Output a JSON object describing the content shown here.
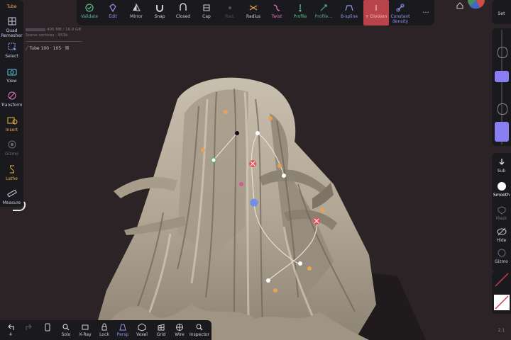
{
  "colors": {
    "background": "#2b2326",
    "panel": "#1a1a1e",
    "hair": "#b5aa98",
    "accent_purple": "#8a7ff2",
    "accent_red": "#b8434a"
  },
  "left_panel": {
    "title": "Tube",
    "items": [
      {
        "label": "Quad Remesher",
        "icon": "quad-remesher-icon"
      },
      {
        "label": "Select",
        "icon": "select-icon"
      },
      {
        "label": "View",
        "icon": "camera-icon"
      },
      {
        "label": "Transform",
        "icon": "transform-icon"
      },
      {
        "label": "Insert",
        "icon": "insert-icon"
      },
      {
        "label": "Gizmo",
        "icon": "gizmo-icon"
      },
      {
        "label": "Lathe",
        "icon": "lathe-icon"
      },
      {
        "label": "Measure",
        "icon": "ruler-icon"
      }
    ]
  },
  "top_bar": {
    "items": [
      {
        "label": "Validate",
        "icon": "check-circle-icon"
      },
      {
        "label": "Edit",
        "icon": "edit-icon"
      },
      {
        "label": "Mirror",
        "icon": "mirror-icon"
      },
      {
        "label": "Snap",
        "icon": "magnet-icon"
      },
      {
        "label": "Closed",
        "icon": "closed-icon"
      },
      {
        "label": "Cap",
        "icon": "cap-icon"
      },
      {
        "label": "Rad.",
        "icon": "radius-small-icon"
      },
      {
        "label": "Radius",
        "icon": "radius-icon"
      },
      {
        "label": "Twist",
        "icon": "twist-icon"
      },
      {
        "label": "Profile",
        "icon": "profile-icon"
      },
      {
        "label": "Profile...",
        "icon": "profile-more-icon"
      },
      {
        "label": "B-spline",
        "icon": "bspline-icon"
      },
      {
        "label": "+ Division",
        "icon": "division-icon"
      },
      {
        "label": "Constant density",
        "icon": "link-icon"
      }
    ],
    "more": "..."
  },
  "stats": {
    "memory": "400 MB / 10.6 GB",
    "vertices": "Scene vertices : 953k"
  },
  "tube_label": "Tube 100 · 105 · ",
  "right_panel": {
    "set_label": "Set",
    "sub": "Sub",
    "smooth": "Smooth",
    "mask": "Mask",
    "hide": "Hide",
    "gizmo": "Gizmo",
    "version": "2.1"
  },
  "bottom_bar": {
    "items": [
      {
        "label": "",
        "icon": "undo-icon"
      },
      {
        "label": "",
        "icon": "redo-icon"
      },
      {
        "label": "",
        "icon": "phone-icon"
      },
      {
        "label": "Solo",
        "icon": "search-icon"
      },
      {
        "label": "X-Ray",
        "icon": "xray-icon"
      },
      {
        "label": "Lock",
        "icon": "lock-icon"
      },
      {
        "label": "Persp",
        "icon": "perspective-icon"
      },
      {
        "label": "Voxel",
        "icon": "voxel-icon"
      },
      {
        "label": "Grid",
        "icon": "grid-icon"
      },
      {
        "label": "Wire",
        "icon": "wire-icon"
      },
      {
        "label": "Inspector",
        "icon": "inspector-icon"
      }
    ],
    "undo_count": "4"
  }
}
